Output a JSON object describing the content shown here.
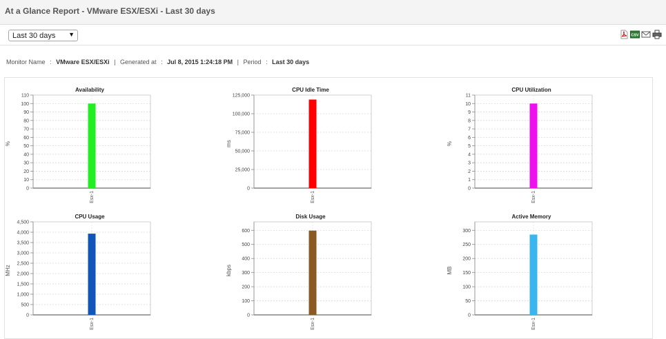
{
  "header": {
    "title": "At a Glance Report - VMware ESX/ESXi - Last 30 days"
  },
  "toolbar": {
    "period_select": {
      "value": "Last 30 days",
      "arrow": "▼"
    },
    "icons": [
      "pdf-icon",
      "csv-icon",
      "email-icon",
      "print-icon"
    ],
    "icon_labels": {
      "csv": "CSV"
    }
  },
  "meta": {
    "monitor_name_label": "Monitor Name",
    "monitor_name_value": "VMware ESX/ESXi",
    "generated_label": "Generated at",
    "generated_value": "Jul 8, 2015 1:24:18 PM",
    "period_label": "Period",
    "period_value": "Last 30 days",
    "colon": ":",
    "pipe": "|"
  },
  "chart_data": [
    {
      "type": "bar",
      "title": "Availability",
      "ylabel": "%",
      "categories": [
        "Esx-1"
      ],
      "values": [
        100
      ],
      "ylim": [
        0,
        110
      ],
      "yticks": [
        "0",
        "10",
        "20",
        "30",
        "40",
        "50",
        "60",
        "70",
        "80",
        "90",
        "100",
        "110"
      ],
      "color": "#22ee22",
      "grid": true
    },
    {
      "type": "bar",
      "title": "CPU Idle Time",
      "ylabel": "ms",
      "categories": [
        "Esx-1"
      ],
      "values": [
        119000
      ],
      "ylim": [
        0,
        125000
      ],
      "yticks": [
        "0",
        "25,000",
        "50,000",
        "75,000",
        "100,000",
        "125,000"
      ],
      "color": "#ff0000",
      "grid": true
    },
    {
      "type": "bar",
      "title": "CPU Utilization",
      "ylabel": "%",
      "categories": [
        "Esx-1"
      ],
      "values": [
        10
      ],
      "ylim": [
        0,
        11
      ],
      "yticks": [
        "0",
        "1",
        "2",
        "3",
        "4",
        "5",
        "6",
        "7",
        "8",
        "9",
        "10",
        "11"
      ],
      "color": "#ee11ee",
      "grid": true
    },
    {
      "type": "bar",
      "title": "CPU Usage",
      "ylabel": "MHz",
      "categories": [
        "Esx-1"
      ],
      "values": [
        3930
      ],
      "ylim": [
        0,
        4500
      ],
      "yticks": [
        "0",
        "500",
        "1,000",
        "1,500",
        "2,000",
        "2,500",
        "3,000",
        "3,500",
        "4,000",
        "4,500"
      ],
      "color": "#1155bb",
      "grid": true
    },
    {
      "type": "bar",
      "title": "Disk Usage",
      "ylabel": "kbps",
      "categories": [
        "Esx-1"
      ],
      "values": [
        598
      ],
      "ylim": [
        0,
        660
      ],
      "yticks": [
        "0",
        "100",
        "200",
        "300",
        "400",
        "500",
        "600"
      ],
      "color": "#8a5a22",
      "grid": true
    },
    {
      "type": "bar",
      "title": "Active Memory",
      "ylabel": "MB",
      "categories": [
        "Esx-1"
      ],
      "values": [
        285
      ],
      "ylim": [
        0,
        330
      ],
      "yticks": [
        "0",
        "50",
        "100",
        "150",
        "200",
        "250",
        "300"
      ],
      "color": "#3ab6ee",
      "grid": true
    }
  ]
}
